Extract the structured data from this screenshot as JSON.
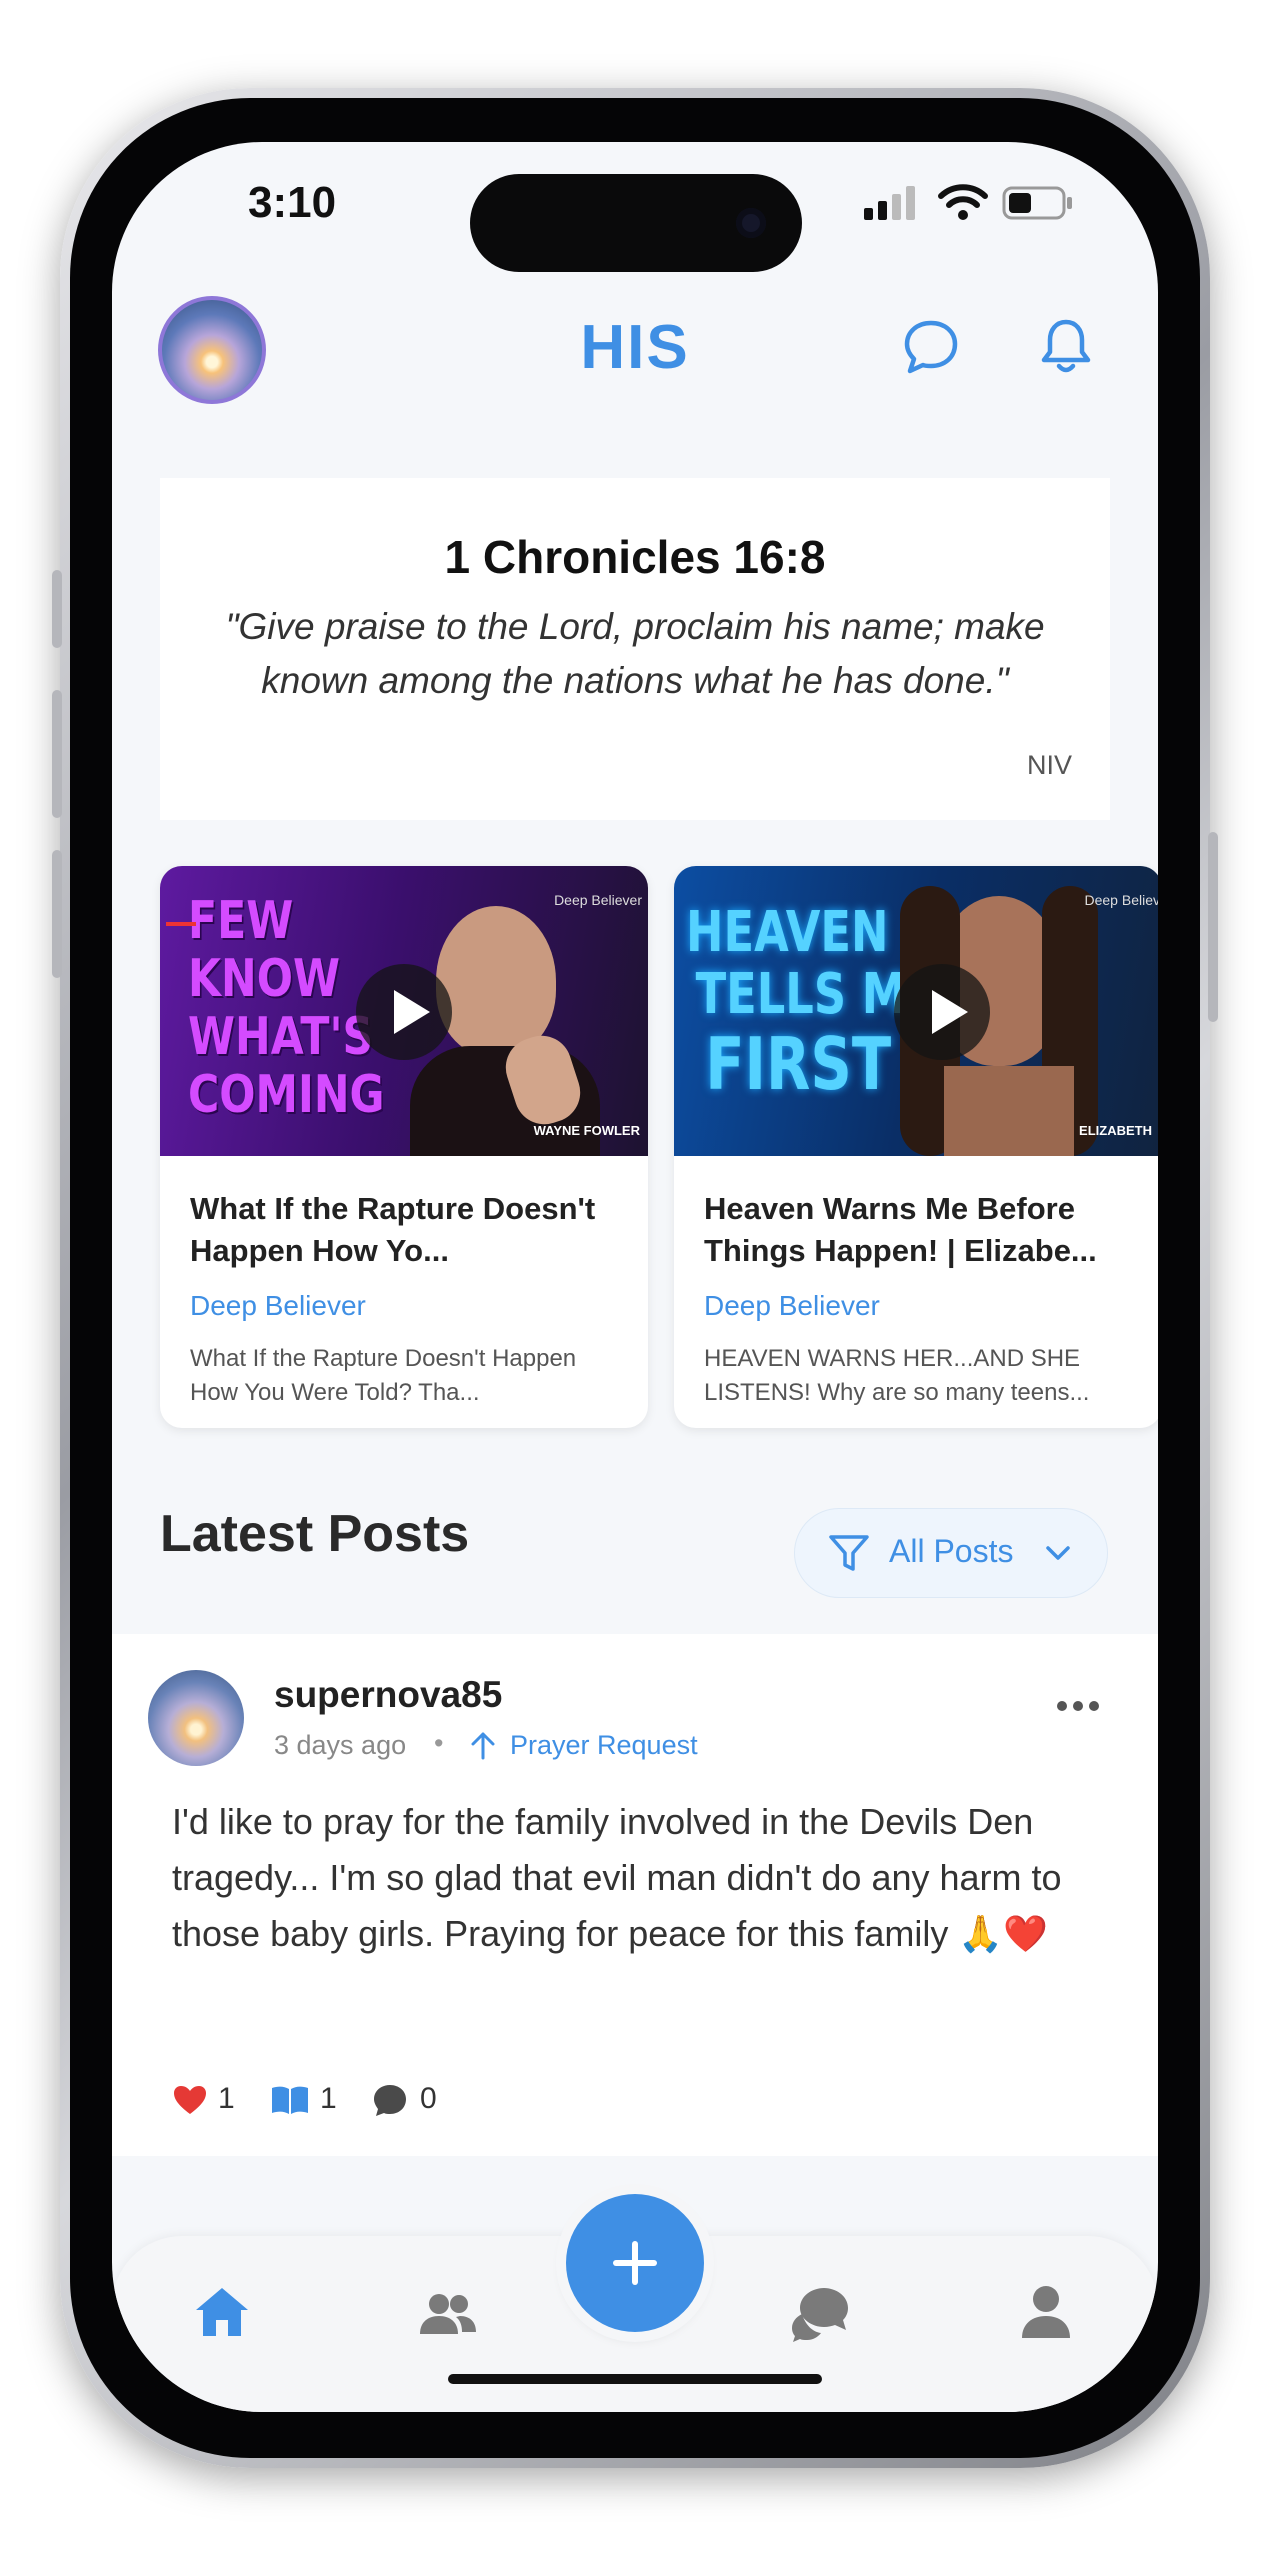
{
  "status_bar": {
    "time": "3:10"
  },
  "header": {
    "title": "HIS"
  },
  "verse": {
    "reference": "1 Chronicles 16:8",
    "text": "\"Give praise to the Lord, proclaim his name; make known among the nations what he has done.\"",
    "version": "NIV"
  },
  "videos": [
    {
      "thumb_text": [
        "FEW",
        "KNOW",
        "WHAT'S",
        "COMING"
      ],
      "thumb_brand": "Deep Believer",
      "thumb_name": "WAYNE FOWLER",
      "title": "What If the Rapture Doesn't Happen How Yo...",
      "channel": "Deep Believer",
      "description": "What If the Rapture Doesn't Happen How You Were Told? Tha..."
    },
    {
      "thumb_text": [
        "HEAVEN",
        "TELLS ME",
        "FIRST"
      ],
      "thumb_brand": "Deep Believ",
      "thumb_name": "ELIZABETH",
      "title": "Heaven Warns Me Before Things Happen! | Elizabe...",
      "channel": "Deep Believer",
      "description": "HEAVEN WARNS HER...AND SHE LISTENS! Why are so many teens..."
    }
  ],
  "latest": {
    "heading": "Latest Posts",
    "filter_label": "All Posts"
  },
  "post": {
    "username": "supernova85",
    "time": "3 days ago",
    "separator": "•",
    "category": "Prayer Request",
    "body": "I'd like to pray for the family involved in the Devils Den tragedy... I'm so glad that evil man didn't do any harm to those baby girls. Praying for peace for this family 🙏❤️",
    "reactions": {
      "hearts": "1",
      "bibles": "1",
      "comments": "0"
    }
  },
  "colors": {
    "accent": "#3f8fe4",
    "background": "#f5f7fa",
    "heart": "#e53935"
  },
  "icons": {
    "header": [
      "profile-avatar",
      "chat-icon",
      "bell-icon"
    ],
    "tabbar": [
      "home-icon",
      "people-icon",
      "plus-icon",
      "messages-icon",
      "person-icon"
    ]
  }
}
